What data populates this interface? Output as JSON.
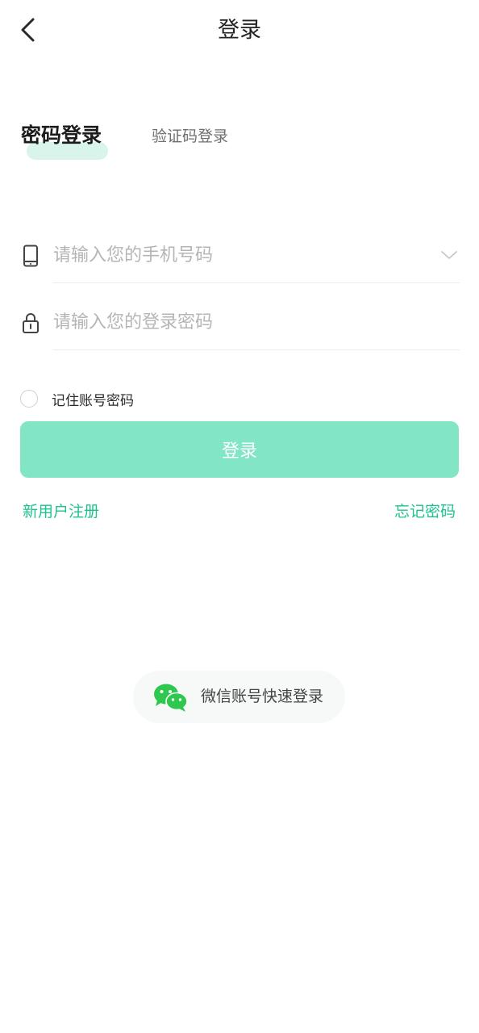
{
  "header": {
    "title": "登录"
  },
  "tabs": [
    {
      "label": "密码登录",
      "active": true
    },
    {
      "label": "验证码登录",
      "active": false
    }
  ],
  "form": {
    "phone": {
      "value": "",
      "placeholder": "请输入您的手机号码",
      "icon": "phone-icon"
    },
    "password": {
      "value": "",
      "placeholder": "请输入您的登录密码",
      "icon": "lock-icon"
    },
    "remember_label": "记住账号密码",
    "remember_checked": false,
    "login_label": "登录"
  },
  "links": {
    "register": "新用户注册",
    "forgot": "忘记密码"
  },
  "wechat": {
    "label": "微信账号快速登录",
    "icon": "wechat-icon"
  },
  "colors": {
    "accent": "#1fc28f",
    "button_bg": "#82e5c5",
    "tab_highlight": "#d9f5eb",
    "wechat_green": "#2dc84d"
  }
}
